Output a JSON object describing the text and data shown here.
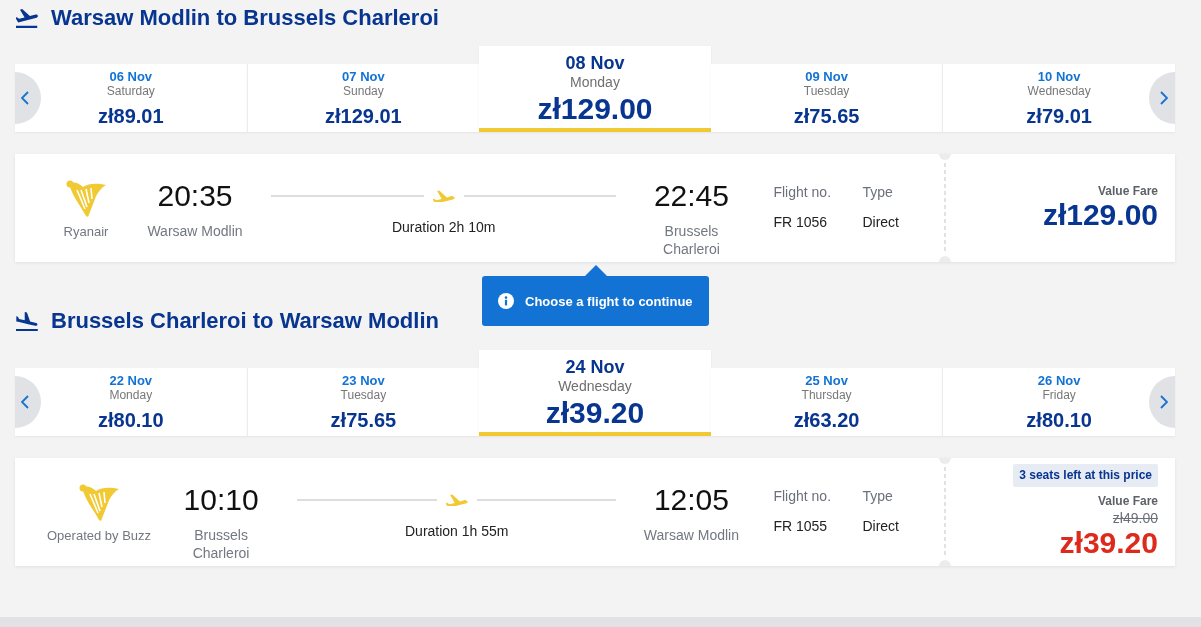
{
  "sections": [
    {
      "kind": "takeoff",
      "title": "Warsaw Modlin to Brussels Charleroi",
      "dates": [
        {
          "date": "06 Nov",
          "day": "Saturday",
          "price": "zł89.01",
          "selected": false
        },
        {
          "date": "07 Nov",
          "day": "Sunday",
          "price": "zł129.01",
          "selected": false
        },
        {
          "date": "08 Nov",
          "day": "Monday",
          "price": "zł129.00",
          "selected": true
        },
        {
          "date": "09 Nov",
          "day": "Tuesday",
          "price": "zł75.65",
          "selected": false
        },
        {
          "date": "10 Nov",
          "day": "Wednesday",
          "price": "zł79.01",
          "selected": false
        }
      ],
      "flight": {
        "airline": "Ryanair",
        "departure_time": "20:35",
        "departure_airport": "Warsaw Modlin",
        "duration": "Duration 2h 10m",
        "arrival_time": "22:45",
        "arrival_airport": "Brussels Charleroi",
        "flight_no_label": "Flight no.",
        "flight_no": "FR 1056",
        "type_label": "Type",
        "type": "Direct",
        "fare": {
          "name": "Value Fare",
          "price": "zł129.00",
          "discount": false
        }
      },
      "tooltip": "Choose a flight to continue"
    },
    {
      "kind": "landing",
      "title": "Brussels Charleroi to Warsaw Modlin",
      "dates": [
        {
          "date": "22 Nov",
          "day": "Monday",
          "price": "zł80.10",
          "selected": false
        },
        {
          "date": "23 Nov",
          "day": "Tuesday",
          "price": "zł75.65",
          "selected": false
        },
        {
          "date": "24 Nov",
          "day": "Wednesday",
          "price": "zł39.20",
          "selected": true
        },
        {
          "date": "25 Nov",
          "day": "Thursday",
          "price": "zł63.20",
          "selected": false
        },
        {
          "date": "26 Nov",
          "day": "Friday",
          "price": "zł80.10",
          "selected": false
        }
      ],
      "flight": {
        "airline": "Operated by Buzz",
        "departure_time": "10:10",
        "departure_airport": "Brussels Charleroi",
        "duration": "Duration 1h 55m",
        "arrival_time": "12:05",
        "arrival_airport": "Warsaw Modlin",
        "flight_no_label": "Flight no.",
        "flight_no": "FR 1055",
        "type_label": "Type",
        "type": "Direct",
        "fare": {
          "badge": "3 seats left at this price",
          "name": "Value Fare",
          "old_price": "zł49.00",
          "price": "zł39.20",
          "discount": true
        }
      }
    }
  ]
}
